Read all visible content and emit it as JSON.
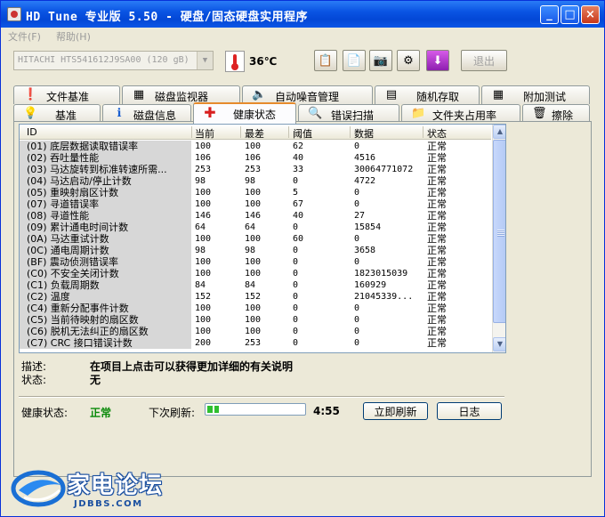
{
  "window": {
    "title": "HD Tune 专业版 5.50 - 硬盘/固态硬盘实用程序",
    "minimize": "_",
    "maximize": "□",
    "close": "×"
  },
  "menu": [
    "文件(F)",
    "帮助(H)"
  ],
  "toolbar": {
    "drive": "HITACHI HTS541612J9SA00 (120 gB)",
    "temperature": "36℃",
    "buttons": [
      {
        "name": "copy-text-icon",
        "glyph": "📋"
      },
      {
        "name": "copy-info-icon",
        "glyph": "📄"
      },
      {
        "name": "screenshot-camera-icon",
        "glyph": "📷"
      },
      {
        "name": "options-icon",
        "glyph": "⚙"
      },
      {
        "name": "save-download-icon",
        "glyph": "⬇"
      }
    ],
    "exit": "退出"
  },
  "tabs_row1": [
    {
      "label": "文件基准",
      "icon": "file-benchmark-icon",
      "glyph": "❗"
    },
    {
      "label": "磁盘监视器",
      "icon": "disk-monitor-icon",
      "glyph": "▦"
    },
    {
      "label": "自动噪音管理",
      "icon": "speaker-icon",
      "glyph": "🔈"
    },
    {
      "label": "随机存取",
      "icon": "random-access-icon",
      "glyph": "▤"
    },
    {
      "label": "附加测试",
      "icon": "extra-tests-icon",
      "glyph": "▦"
    }
  ],
  "tabs_row2": [
    {
      "label": "基准",
      "icon": "benchmark-bulb-icon",
      "glyph": "💡"
    },
    {
      "label": "磁盘信息",
      "icon": "info-icon",
      "glyph": "ℹ"
    },
    {
      "label": "健康状态",
      "icon": "health-cross-icon",
      "glyph": "✚"
    },
    {
      "label": "错误扫描",
      "icon": "magnifier-icon",
      "glyph": "🔍"
    },
    {
      "label": "文件夹占用率",
      "icon": "folder-icon",
      "glyph": "📁"
    },
    {
      "label": "擦除",
      "icon": "trash-icon",
      "glyph": "🗑"
    }
  ],
  "table": {
    "columns": [
      "ID",
      "当前",
      "最差",
      "阈值",
      "数据",
      "状态"
    ],
    "rows": [
      [
        "(01) 底层数据读取错误率",
        "100",
        "100",
        "62",
        "0",
        "正常"
      ],
      [
        "(02) 吞吐量性能",
        "106",
        "106",
        "40",
        "4516",
        "正常"
      ],
      [
        "(03) 马达旋转到标准转速所需...",
        "253",
        "253",
        "33",
        "30064771072",
        "正常"
      ],
      [
        "(04) 马达启动/停止计数",
        "98",
        "98",
        "0",
        "4722",
        "正常"
      ],
      [
        "(05) 重映射扇区计数",
        "100",
        "100",
        "5",
        "0",
        "正常"
      ],
      [
        "(07) 寻道错误率",
        "100",
        "100",
        "67",
        "0",
        "正常"
      ],
      [
        "(08) 寻道性能",
        "146",
        "146",
        "40",
        "27",
        "正常"
      ],
      [
        "(09) 累计通电时间计数",
        "64",
        "64",
        "0",
        "15854",
        "正常"
      ],
      [
        "(0A) 马达重试计数",
        "100",
        "100",
        "60",
        "0",
        "正常"
      ],
      [
        "(0C) 通电周期计数",
        "98",
        "98",
        "0",
        "3658",
        "正常"
      ],
      [
        "(BF) 震动侦测错误率",
        "100",
        "100",
        "0",
        "0",
        "正常"
      ],
      [
        "(C0) 不安全关闭计数",
        "100",
        "100",
        "0",
        "1823015039",
        "正常"
      ],
      [
        "(C1) 负载周期数",
        "84",
        "84",
        "0",
        "160929",
        "正常"
      ],
      [
        "(C2) 温度",
        "152",
        "152",
        "0",
        "21045339...",
        "正常"
      ],
      [
        "(C4) 重新分配事件计数",
        "100",
        "100",
        "0",
        "0",
        "正常"
      ],
      [
        "(C5) 当前待映射的扇区数",
        "100",
        "100",
        "0",
        "0",
        "正常"
      ],
      [
        "(C6) 脱机无法纠正的扇区数",
        "100",
        "100",
        "0",
        "0",
        "正常"
      ],
      [
        "(C7) CRC 接口错误计数",
        "200",
        "253",
        "0",
        "0",
        "正常"
      ]
    ]
  },
  "description": {
    "label": "描述:",
    "value": "在项目上点击可以获得更加详细的有关说明"
  },
  "state": {
    "label": "状态:",
    "value": "无"
  },
  "footer": {
    "health_label": "健康状态:",
    "health_value": "正常",
    "next_refresh_label": "下次刷新:",
    "countdown": "4:55",
    "progress": 0.12,
    "refresh_button": "立即刷新",
    "log_button": "日志"
  },
  "watermark": {
    "text": "家电论坛",
    "sub": "JDBBS.COM"
  },
  "colors": {
    "accent": "#0a54e3",
    "ok": "#0a8a0a",
    "active_tab": "#e68b2c",
    "health_icon": "#d81e1e",
    "download_icon": "#9c27b0"
  }
}
